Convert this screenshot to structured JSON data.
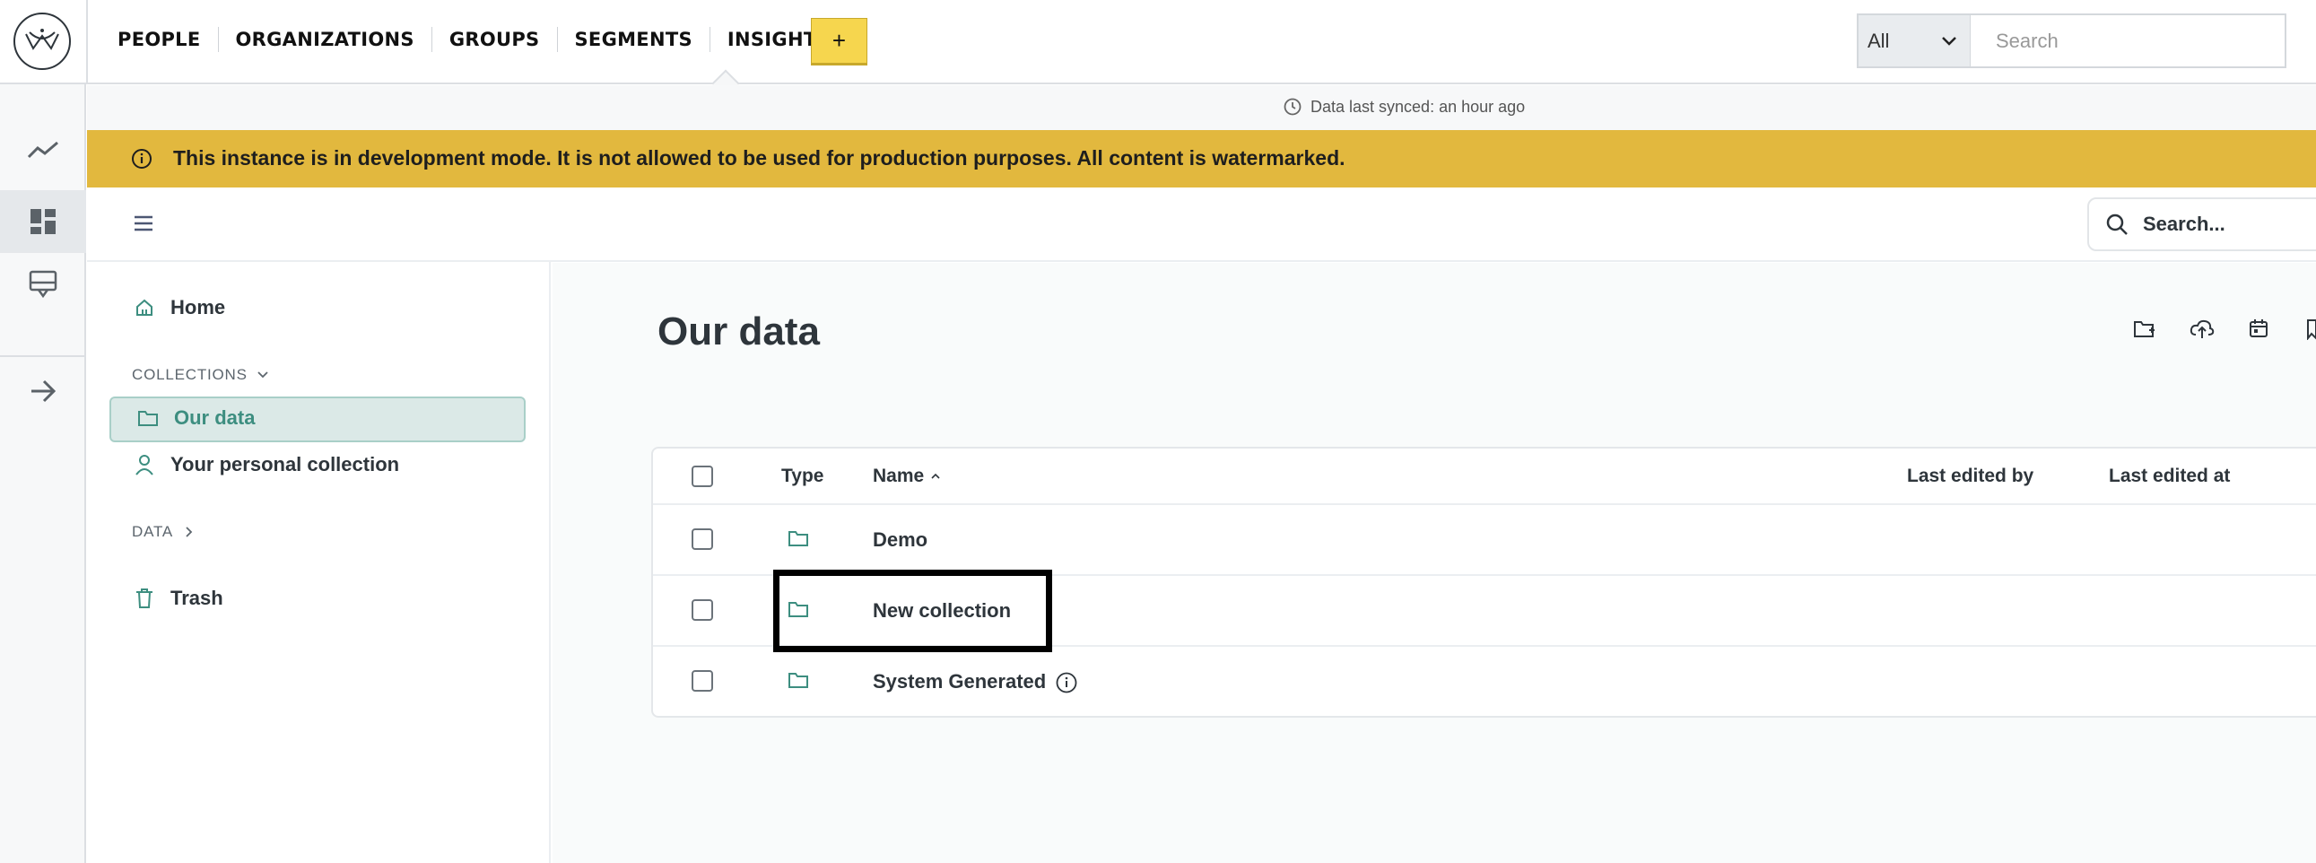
{
  "topnav": {
    "links": [
      "PEOPLE",
      "ORGANIZATIONS",
      "GROUPS",
      "SEGMENTS",
      "INSIGHTS"
    ],
    "add_label": "+",
    "search_scope": "All",
    "search_placeholder": "Search",
    "active_link": "INSIGHTS"
  },
  "rail": {
    "icons": [
      "trend-line-icon",
      "dashboard-icon",
      "kiosk-icon",
      "expand-arrow-icon"
    ],
    "active_icon": "dashboard-icon"
  },
  "sync": {
    "text": "Data last synced: an hour ago"
  },
  "banner": {
    "message": "This instance is in development mode. It is not allowed to be used for production purposes. All content is watermarked.",
    "color": "#e2b83e"
  },
  "app_header": {
    "search_placeholder": "Search..."
  },
  "sidebar": {
    "home_label": "Home",
    "collections_heading": "COLLECTIONS",
    "items": [
      {
        "label": "Our data",
        "selected": true
      },
      {
        "label": "Your personal collection",
        "selected": false
      }
    ],
    "data_heading": "DATA",
    "trash_label": "Trash",
    "accent_color": "#509ee3"
  },
  "main": {
    "title": "Our data",
    "toolbar_icons": [
      "new-folder-icon",
      "upload-icon",
      "calendar-icon",
      "bookmark-icon"
    ],
    "table": {
      "headers": {
        "type": "Type",
        "name": "Name",
        "name_sort": "ascending",
        "last_edited_by": "Last edited by",
        "last_edited_at": "Last edited at"
      },
      "rows": [
        {
          "name": "Demo",
          "info": false
        },
        {
          "name": "New collection",
          "info": false,
          "highlighted": true
        },
        {
          "name": "System Generated",
          "info": true
        }
      ]
    }
  }
}
